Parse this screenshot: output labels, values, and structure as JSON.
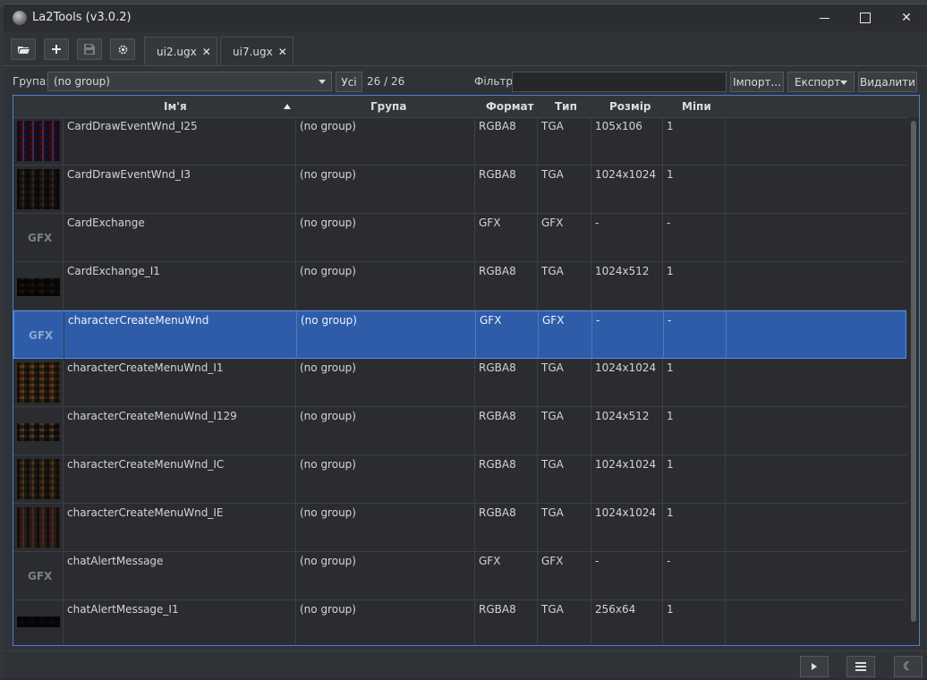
{
  "window": {
    "title": "La2Tools (v3.0.2)"
  },
  "toolbar": {
    "open_icon": "folder-open-icon",
    "add_icon": "plus-icon",
    "save_icon": "save-icon",
    "settings_icon": "gear-icon",
    "tabs": [
      {
        "label": "ui2.ugx",
        "active": true
      },
      {
        "label": "ui7.ugx",
        "active": false
      }
    ]
  },
  "filterbar": {
    "group_label": "Група:",
    "group_value": "(no group)",
    "all_button": "Усі",
    "count": "26 / 26",
    "filter_label": "Фільтр:",
    "filter_value": "",
    "import_button": "Імпорт...",
    "export_button": "Експорт",
    "delete_button": "Видалити"
  },
  "table": {
    "columns": [
      "Ім'я",
      "Група",
      "Формат",
      "Тип",
      "Розмір",
      "Міпи"
    ],
    "sort_column": "Ім'я",
    "sort_direction": "ascending",
    "rows": [
      {
        "thumb": "image",
        "name": "CardDrawEventWnd_I25",
        "group": "(no group)",
        "format": "RGBA8",
        "type": "TGA",
        "size": "105x106",
        "mips": "1"
      },
      {
        "thumb": "image",
        "name": "CardDrawEventWnd_I3",
        "group": "(no group)",
        "format": "RGBA8",
        "type": "TGA",
        "size": "1024x1024",
        "mips": "1"
      },
      {
        "thumb": "GFX",
        "name": "CardExchange",
        "group": "(no group)",
        "format": "GFX",
        "type": "GFX",
        "size": "-",
        "mips": "-"
      },
      {
        "thumb": "image",
        "name": "CardExchange_I1",
        "group": "(no group)",
        "format": "RGBA8",
        "type": "TGA",
        "size": "1024x512",
        "mips": "1"
      },
      {
        "thumb": "GFX",
        "name": "characterCreateMenuWnd",
        "group": "(no group)",
        "format": "GFX",
        "type": "GFX",
        "size": "-",
        "mips": "-",
        "selected": true
      },
      {
        "thumb": "image",
        "name": "characterCreateMenuWnd_I1",
        "group": "(no group)",
        "format": "RGBA8",
        "type": "TGA",
        "size": "1024x1024",
        "mips": "1"
      },
      {
        "thumb": "image",
        "name": "characterCreateMenuWnd_I129",
        "group": "(no group)",
        "format": "RGBA8",
        "type": "TGA",
        "size": "1024x512",
        "mips": "1"
      },
      {
        "thumb": "image",
        "name": "characterCreateMenuWnd_IC",
        "group": "(no group)",
        "format": "RGBA8",
        "type": "TGA",
        "size": "1024x1024",
        "mips": "1"
      },
      {
        "thumb": "image",
        "name": "characterCreateMenuWnd_IE",
        "group": "(no group)",
        "format": "RGBA8",
        "type": "TGA",
        "size": "1024x1024",
        "mips": "1"
      },
      {
        "thumb": "GFX",
        "name": "chatAlertMessage",
        "group": "(no group)",
        "format": "GFX",
        "type": "GFX",
        "size": "-",
        "mips": "-"
      },
      {
        "thumb": "image",
        "name": "chatAlertMessage_I1",
        "group": "(no group)",
        "format": "RGBA8",
        "type": "TGA",
        "size": "256x64",
        "mips": "1"
      }
    ]
  },
  "statusbar": {
    "play_icon": "play-icon",
    "menu_icon": "hamburger-menu-icon",
    "theme_icon": "moon-icon"
  },
  "colors": {
    "accent": "#2e5ca8",
    "background": "#2f3236",
    "tab_dot": "#3d7be0"
  }
}
